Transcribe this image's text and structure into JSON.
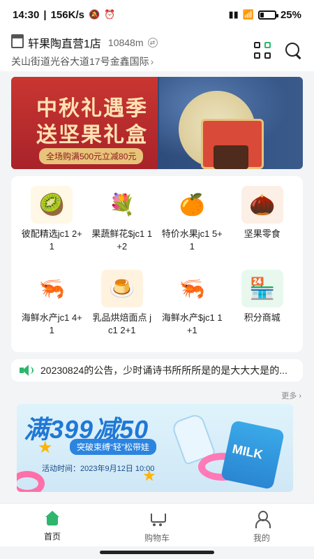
{
  "status_bar": {
    "time": "14:30",
    "speed": "156K/s",
    "battery": "25%",
    "battery_level": 0.25
  },
  "header": {
    "store_name": "轩果陶直营1店",
    "distance": "10848m",
    "address": "关山街道光谷大道17号金鑫国际"
  },
  "banner": {
    "title": "中秋礼遇季",
    "subtitle": "送坚果礼盒",
    "promo": "全场购满500元立减80元"
  },
  "categories": [
    {
      "label": "彼配精选jc1 2+1",
      "icon": "kiwi-basket"
    },
    {
      "label": "果蔬鲜花$jc1 1+2",
      "icon": "flower-bouquet"
    },
    {
      "label": "特价水果jc1 5+1",
      "icon": "oranges"
    },
    {
      "label": "坚果零食",
      "icon": "walnut"
    },
    {
      "label": "海鲜水产jc1 4+1",
      "icon": "shrimp-plate"
    },
    {
      "label": "乳品烘焙面点 jc1 2+1",
      "icon": "pudding"
    },
    {
      "label": "海鲜水产$jc1 1+1",
      "icon": "prawns"
    },
    {
      "label": "积分商城",
      "icon": "points-shop"
    }
  ],
  "notice": {
    "text": "20230824的公告，少时诵诗书所所所是的是大大大是的..."
  },
  "more_label": "更多",
  "promo": {
    "title": "满399减50",
    "badge": "突破束缚“轻”松带娃",
    "time": "活动时间：2023年9月12日 10:00",
    "can_label": "MILK"
  },
  "tabbar": {
    "home": "首页",
    "cart": "购物车",
    "mine": "我的"
  },
  "colors": {
    "accent": "#2eb66c",
    "banner_red": "#c42f2e",
    "promo_blue": "#1f78d6"
  }
}
